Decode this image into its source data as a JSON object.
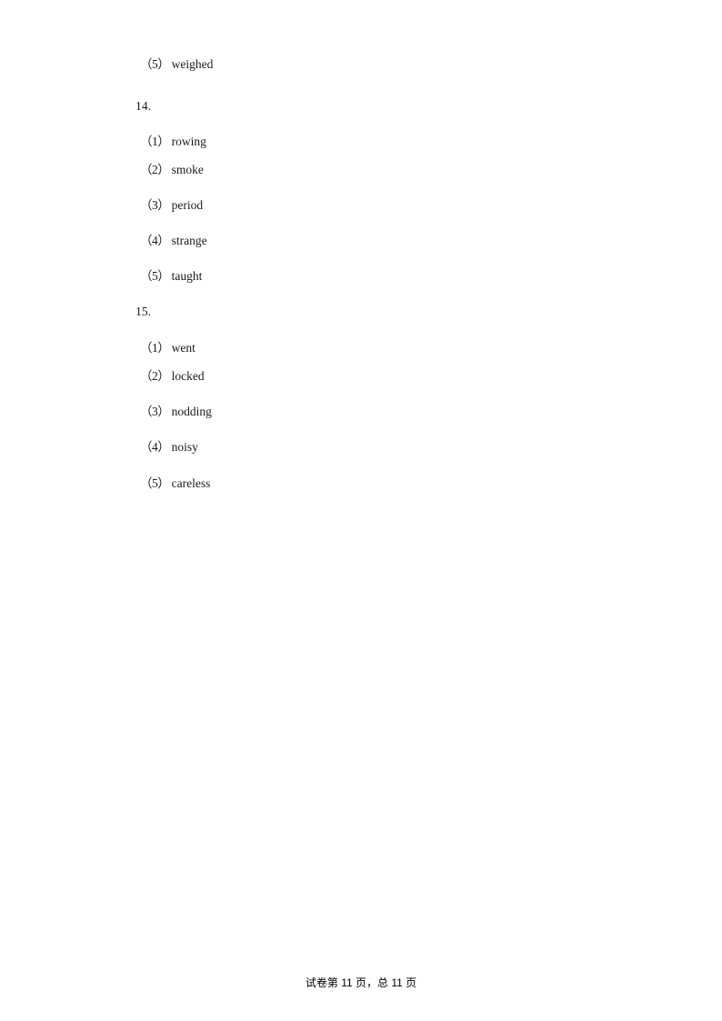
{
  "document": {
    "page_background": "#ffffff",
    "text_color": "#1a1a1a"
  },
  "content": {
    "trailing_option": {
      "marker": "（5）",
      "word": "weighed"
    },
    "questions": [
      {
        "number": "14.",
        "options": [
          {
            "marker": "（1）",
            "word": "rowing"
          },
          {
            "marker": "（2）",
            "word": "smoke"
          },
          {
            "marker": "（3）",
            "word": "period"
          },
          {
            "marker": "（4）",
            "word": "strange"
          },
          {
            "marker": "（5）",
            "word": "taught"
          }
        ]
      },
      {
        "number": "15.",
        "options": [
          {
            "marker": "（1）",
            "word": "went"
          },
          {
            "marker": "（2）",
            "word": "locked"
          },
          {
            "marker": "（3）",
            "word": "nodding"
          },
          {
            "marker": "（4）",
            "word": "noisy"
          },
          {
            "marker": "（5）",
            "word": "careless"
          }
        ]
      }
    ]
  },
  "footer": {
    "text": "试卷第 11 页，总 11 页"
  }
}
